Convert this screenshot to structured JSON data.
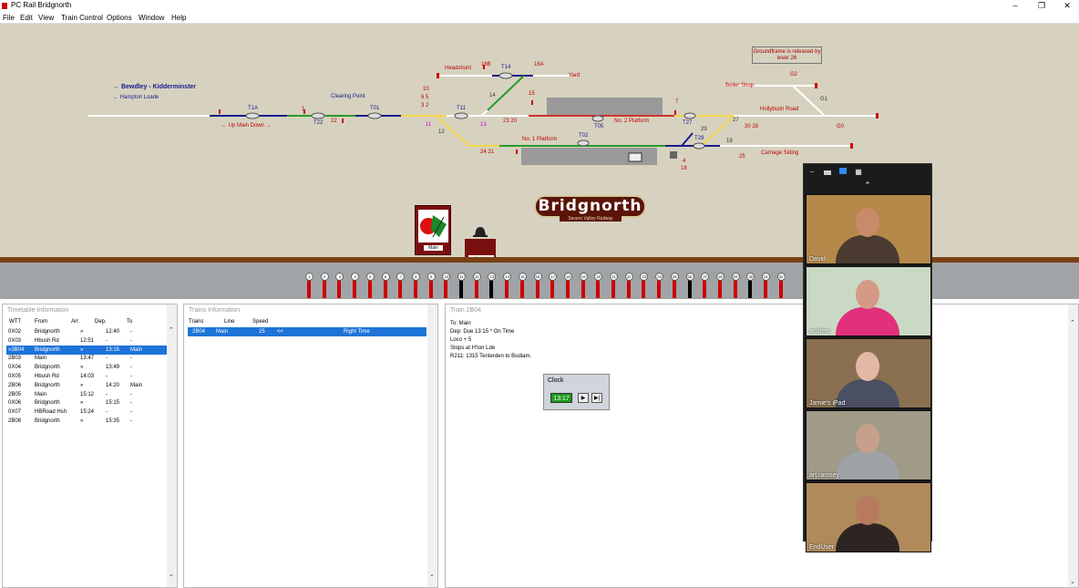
{
  "window": {
    "title": "PC Rail Bridgnorth",
    "minimize": "–",
    "maximize": "❐",
    "close": "✕"
  },
  "menu": [
    "File",
    "Edit",
    "View",
    "Train Control",
    "Options",
    "Window",
    "Help"
  ],
  "diagram": {
    "labels": {
      "bewdley": "← Bewdley - Kidderminster",
      "hampton": "← Hampton Loade",
      "up_main": "← Up  Main  Down →",
      "clearing_point": "Clearing Point",
      "headshunt": "Headshunt",
      "yard": "Yard",
      "no2_platform": "No. 2 Platform",
      "no1_platform": "No. 1 Platform",
      "boiler_shop": "Boiler Shop",
      "hollybush_road": "Hollybush Road",
      "carriage_siding": "Carriage Siding",
      "groundframe": "Groundframe is released by lever 26"
    },
    "track_ids": [
      "T1A",
      "T22",
      "T01",
      "T11",
      "T14",
      "T05",
      "T02",
      "T27",
      "T29"
    ],
    "numbers": {
      "n1": "1",
      "n22": "22",
      "n10": "10",
      "n65": "6  5",
      "n32": "3  2",
      "n11": "11",
      "n12": "12",
      "n13": "13",
      "n16b": "16B",
      "n16a": "16A",
      "n14": "14",
      "n15": "15",
      "n2320": "23 20",
      "n7": "7",
      "n2421": "24 21",
      "n29": "29",
      "n27": "27",
      "n3028": "30 28",
      "n19": "19",
      "n25": "25",
      "n4": "4",
      "n18": "18",
      "g2": "G2",
      "g1": "G1",
      "g0": "G0"
    },
    "brand": "Bridgnorth",
    "brand_sub": "Severn Valley Railway",
    "lever_box_label": "Main",
    "bell_label": "H'ton Lde"
  },
  "frame": {
    "levers": [
      "1",
      "2",
      "3",
      "4",
      "5",
      "6",
      "7",
      "8",
      "9",
      "10",
      "11",
      "12",
      "13",
      "14",
      "15",
      "16",
      "17",
      "18",
      "19",
      "20",
      "21",
      "22",
      "23",
      "24",
      "25",
      "26",
      "27",
      "28",
      "29",
      "30",
      "31",
      "32"
    ],
    "lever_colors": [
      "#c00",
      "#c00",
      "#c00",
      "#c00",
      "#c00",
      "#c00",
      "#c00",
      "#c00",
      "#c00",
      "#c00",
      "#000",
      "#c00",
      "#000",
      "#c00",
      "#c00",
      "#c00",
      "#c00",
      "#c00",
      "#c00",
      "#c00",
      "#c00",
      "#c00",
      "#c00",
      "#c00",
      "#c00",
      "#000",
      "#c00",
      "#c00",
      "#c00",
      "#000",
      "#c00",
      "#c00"
    ]
  },
  "timetable": {
    "title": "Timetable Information",
    "headers": [
      "WTT",
      "From",
      "Arr.",
      "Dep.",
      "To"
    ],
    "rows": [
      {
        "wtt": "0X02",
        "from": "Bridgnorth",
        "arr": "»",
        "dep": "12:40",
        "to": "-"
      },
      {
        "wtt": "0X03",
        "from": "Hbush Rd",
        "arr": "12:51",
        "dep": "-",
        "to": "-"
      },
      {
        "wtt": "»2B04",
        "from": "Bridgnorth",
        "arr": "»",
        "dep": "13:15",
        "to": "Main"
      },
      {
        "wtt": "2B03",
        "from": "Main",
        "arr": "13:47",
        "dep": "-",
        "to": "-"
      },
      {
        "wtt": "0X04",
        "from": "Bridgnorth",
        "arr": "»",
        "dep": "13:49",
        "to": "-"
      },
      {
        "wtt": "0X05",
        "from": "Hbush Rd",
        "arr": "14:03",
        "dep": "-",
        "to": "-"
      },
      {
        "wtt": "2B06",
        "from": "Bridgnorth",
        "arr": "»",
        "dep": "14:20",
        "to": "Main"
      },
      {
        "wtt": "2B05",
        "from": "Main",
        "arr": "15:12",
        "dep": "-",
        "to": "-"
      },
      {
        "wtt": "0X06",
        "from": "Bridgnorth",
        "arr": "»",
        "dep": "15:15",
        "to": "-"
      },
      {
        "wtt": "0X07",
        "from": "HBRoad Hsh",
        "arr": "15:24",
        "dep": "-",
        "to": "-"
      },
      {
        "wtt": "2B08",
        "from": "Bridgnorth",
        "arr": "»",
        "dep": "15:35",
        "to": "-"
      }
    ]
  },
  "trains": {
    "title": "Trains Information",
    "headers": [
      "Trains",
      "Line",
      "Speed"
    ],
    "row": {
      "train": "2B04",
      "line": "Main",
      "speed": "25",
      "dir": "<<",
      "status": "Right Time"
    }
  },
  "train_detail": {
    "title": "Train 2B04",
    "lines": [
      "To: Main",
      "Dep: Due 13:15 * On Time",
      "Loco + 5",
      "Stops at H'ton Lde",
      "R211: 1315 Tenterden to Bodiam."
    ]
  },
  "clock": {
    "title": "Clock",
    "time": "13:17",
    "play": "▶",
    "skip": "▶|"
  },
  "video": {
    "participants": [
      {
        "name": "David",
        "bg": "#b5894a",
        "skin": "#c98a6a",
        "shirt": "#4a3a30"
      },
      {
        "name": "andrew",
        "bg": "#c9d9c4",
        "skin": "#d49a86",
        "shirt": "#e0317a"
      },
      {
        "name": "Jamie's iPad",
        "bg": "#8a7050",
        "skin": "#e3b9a5",
        "shirt": "#4b4f63"
      },
      {
        "name": "art.ramsey",
        "bg": "#a09a88",
        "skin": "#c7a08c",
        "shirt": "#9fa3a7"
      },
      {
        "name": "EndUser",
        "bg": "#b08a5a",
        "skin": "#b77a5e",
        "shirt": "#2d2522"
      }
    ]
  }
}
